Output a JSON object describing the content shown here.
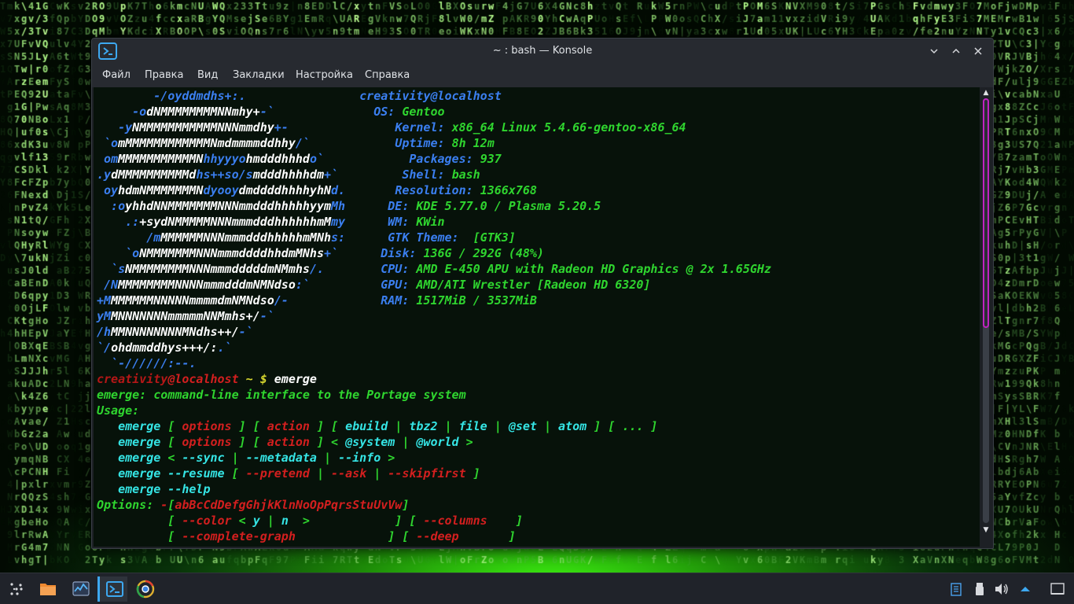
{
  "window": {
    "title": "~ : bash — Konsole",
    "menu": [
      "Файл",
      "Правка",
      "Вид",
      "Закладки",
      "Настройка",
      "Справка"
    ],
    "controls": [
      "chevron-down-icon",
      "chevron-up-icon",
      "close-icon"
    ]
  },
  "colors": {
    "blue": "#3b7ff0",
    "white": "#ffffff",
    "green": "#2fd52f",
    "cyan": "#35e5e5",
    "red": "#d31f1f",
    "dark_red": "#b51717",
    "yellow": "#d7d72e",
    "accent": "#3da8f0",
    "scroll_thumb": "#c023c0"
  },
  "terminal": {
    "lines": [
      [
        [
          "        -/oyddmdhs+:.",
          "blue"
        ],
        [
          "                ",
          "white"
        ],
        [
          "creativity@localhost",
          "blue"
        ]
      ],
      [
        [
          "     -o",
          "blue"
        ],
        [
          "dNMMMMMMMMNNmhy+",
          "white"
        ],
        [
          "-`",
          "blue"
        ],
        [
          "              ",
          "white"
        ],
        [
          "OS: ",
          "blue"
        ],
        [
          "Gentoo",
          "green"
        ]
      ],
      [
        [
          "   -y",
          "blue"
        ],
        [
          "NMMMMMMMMMMMNNNmmdhy",
          "white"
        ],
        [
          "+-",
          "blue"
        ],
        [
          "               ",
          "white"
        ],
        [
          "Kernel: ",
          "blue"
        ],
        [
          "x86_64 Linux 5.4.66-gentoo-x86_64",
          "green"
        ]
      ],
      [
        [
          " `o",
          "blue"
        ],
        [
          "mMMMMMMMMMMMMNmdmmmmddhhy",
          "white"
        ],
        [
          "/`",
          "blue"
        ],
        [
          "            ",
          "white"
        ],
        [
          "Uptime: ",
          "blue"
        ],
        [
          "8h 12m",
          "green"
        ]
      ],
      [
        [
          " om",
          "blue"
        ],
        [
          "MMMMMMMMMMMN",
          "white"
        ],
        [
          "hhyyyo",
          "blue"
        ],
        [
          "hmdddhhhd",
          "white"
        ],
        [
          "o`",
          "blue"
        ],
        [
          "            ",
          "white"
        ],
        [
          "Packages: ",
          "blue"
        ],
        [
          "937",
          "green"
        ]
      ],
      [
        [
          ".y",
          "blue"
        ],
        [
          "dMMMMMMMMMMd",
          "white"
        ],
        [
          "hs++so/s",
          "blue"
        ],
        [
          "mdddhhhhdm",
          "white"
        ],
        [
          "+`",
          "blue"
        ],
        [
          "         ",
          "white"
        ],
        [
          "Shell: ",
          "blue"
        ],
        [
          "bash",
          "green"
        ]
      ],
      [
        [
          " oy",
          "blue"
        ],
        [
          "hdmNMMMMMMMN",
          "white"
        ],
        [
          "dyooy",
          "blue"
        ],
        [
          "dmddddhhhhyhN",
          "white"
        ],
        [
          "d.",
          "blue"
        ],
        [
          "       ",
          "white"
        ],
        [
          "Resolution: ",
          "blue"
        ],
        [
          "1366x768",
          "green"
        ]
      ],
      [
        [
          "  :o",
          "blue"
        ],
        [
          "yhhdNNMMMMMMMNNNmmdddhhhhhyym",
          "white"
        ],
        [
          "Mh",
          "blue"
        ],
        [
          "      ",
          "white"
        ],
        [
          "DE: ",
          "blue"
        ],
        [
          "KDE 5.77.0 / Plasma 5.20.5",
          "green"
        ]
      ],
      [
        [
          "    .:",
          "blue"
        ],
        [
          "+sydNMMMMMNNNmmmdddhhhhhhmM",
          "white"
        ],
        [
          "my",
          "blue"
        ],
        [
          "      ",
          "white"
        ],
        [
          "WM: ",
          "blue"
        ],
        [
          "KWin",
          "green"
        ]
      ],
      [
        [
          "       /m",
          "blue"
        ],
        [
          "MMMMMMNNNmmmdddhhhhhmMNh",
          "white"
        ],
        [
          "s:",
          "blue"
        ],
        [
          "      ",
          "white"
        ],
        [
          "GTK Theme: ",
          "blue"
        ],
        [
          " [GTK3]",
          "green"
        ]
      ],
      [
        [
          "    `o",
          "blue"
        ],
        [
          "NMMMMMMMNNNmmmddddhhdmMNhs",
          "white"
        ],
        [
          "+`",
          "blue"
        ],
        [
          "      ",
          "white"
        ],
        [
          "Disk: ",
          "blue"
        ],
        [
          "136G / 292G (48%)",
          "green"
        ]
      ],
      [
        [
          "  `s",
          "blue"
        ],
        [
          "NMMMMMMMMNNNmmmdddddmNMmhs",
          "white"
        ],
        [
          "/.",
          "blue"
        ],
        [
          "        ",
          "white"
        ],
        [
          "CPU: ",
          "blue"
        ],
        [
          "AMD E-450 APU with Radeon HD Graphics @ 2x 1.65GHz",
          "green"
        ]
      ],
      [
        [
          " /N",
          "blue"
        ],
        [
          "MMMMMMMMNNNNmmmdddmNMNdso",
          "white"
        ],
        [
          ":`",
          "blue"
        ],
        [
          "          ",
          "white"
        ],
        [
          "GPU: ",
          "blue"
        ],
        [
          "AMD/ATI Wrestler [Radeon HD 6320]",
          "green"
        ]
      ],
      [
        [
          "+M",
          "blue"
        ],
        [
          "MMMMMMNNNNNmmmmdmNMNdso",
          "white"
        ],
        [
          "/-",
          "blue"
        ],
        [
          "             ",
          "white"
        ],
        [
          "RAM: ",
          "blue"
        ],
        [
          "1517MiB / 3537MiB",
          "green"
        ]
      ],
      [
        [
          "yM",
          "blue"
        ],
        [
          "MNNNNNNNmmmmmNNMmhs+/",
          "white"
        ],
        [
          "-`",
          "blue"
        ]
      ],
      [
        [
          "/h",
          "blue"
        ],
        [
          "MMNNNNNNNNMNdhs++/",
          "white"
        ],
        [
          "-`",
          "blue"
        ]
      ],
      [
        [
          "`/",
          "blue"
        ],
        [
          "ohdmmddhys+++/:",
          "white"
        ],
        [
          ".`",
          "blue"
        ]
      ],
      [
        [
          "  `-//////:--.",
          "blue"
        ]
      ],
      [
        [
          "creativity",
          "dark_red"
        ],
        [
          "@localhost ",
          "red"
        ],
        [
          "~ $ ",
          "yellow"
        ],
        [
          "emerge",
          "white"
        ]
      ],
      [
        [
          "emerge: command-line interface to the Portage system",
          "green"
        ]
      ],
      [
        [
          "Usage:",
          "green"
        ]
      ],
      [
        [
          "   emerge ",
          "cyan"
        ],
        [
          "[ ",
          "green"
        ],
        [
          "options",
          "red"
        ],
        [
          " ] ",
          "green"
        ],
        [
          "[ ",
          "green"
        ],
        [
          "action",
          "red"
        ],
        [
          " ] ",
          "green"
        ],
        [
          "[ ",
          "green"
        ],
        [
          "ebuild",
          "cyan"
        ],
        [
          " | ",
          "green"
        ],
        [
          "tbz2",
          "cyan"
        ],
        [
          " | ",
          "green"
        ],
        [
          "file",
          "cyan"
        ],
        [
          " | ",
          "green"
        ],
        [
          "@set",
          "cyan"
        ],
        [
          " | ",
          "green"
        ],
        [
          "atom",
          "cyan"
        ],
        [
          " ] [ ... ]",
          "green"
        ]
      ],
      [
        [
          "   emerge ",
          "cyan"
        ],
        [
          "[ ",
          "green"
        ],
        [
          "options",
          "red"
        ],
        [
          " ] ",
          "green"
        ],
        [
          "[ ",
          "green"
        ],
        [
          "action",
          "red"
        ],
        [
          " ] ",
          "green"
        ],
        [
          "< ",
          "green"
        ],
        [
          "@system",
          "cyan"
        ],
        [
          " | ",
          "green"
        ],
        [
          "@world",
          "cyan"
        ],
        [
          " >",
          "green"
        ]
      ],
      [
        [
          "   emerge ",
          "cyan"
        ],
        [
          "< ",
          "green"
        ],
        [
          "--sync",
          "cyan"
        ],
        [
          " | ",
          "green"
        ],
        [
          "--metadata",
          "cyan"
        ],
        [
          " | ",
          "green"
        ],
        [
          "--info",
          "cyan"
        ],
        [
          " >",
          "green"
        ]
      ],
      [
        [
          "   emerge --resume ",
          "cyan"
        ],
        [
          "[ ",
          "green"
        ],
        [
          "--pretend",
          "red"
        ],
        [
          " | ",
          "green"
        ],
        [
          "--ask",
          "red"
        ],
        [
          " | ",
          "green"
        ],
        [
          "--skipfirst",
          "red"
        ],
        [
          " ]",
          "green"
        ]
      ],
      [
        [
          "   emerge --help",
          "cyan"
        ]
      ],
      [
        [
          "Options: ",
          "green"
        ],
        [
          "-",
          "red"
        ],
        [
          "[",
          "green"
        ],
        [
          "abBcCdDefgGhjkKlnNoOpPqrsStuUvVw",
          "red"
        ],
        [
          "]",
          "green"
        ]
      ],
      [
        [
          "          [ ",
          "green"
        ],
        [
          "--color",
          "red"
        ],
        [
          " < ",
          "green"
        ],
        [
          "y",
          "cyan"
        ],
        [
          " | ",
          "green"
        ],
        [
          "n",
          "cyan"
        ],
        [
          "  >",
          "green"
        ],
        [
          "            ] [ ",
          "green"
        ],
        [
          "--columns",
          "red"
        ],
        [
          "    ]",
          "green"
        ]
      ],
      [
        [
          "          [ ",
          "green"
        ],
        [
          "--complete-graph",
          "red"
        ],
        [
          "             ] [ ",
          "green"
        ],
        [
          "--deep",
          "red"
        ],
        [
          "       ]",
          "green"
        ]
      ]
    ]
  },
  "taskbar": {
    "apps": [
      "launcher-icon",
      "file-manager-icon",
      "system-monitor-icon",
      "konsole-icon",
      "chrome-icon"
    ],
    "tray": [
      "clipboard-icon",
      "usb-icon",
      "volume-icon",
      "tray-expand-icon",
      "show-desktop-icon"
    ]
  }
}
